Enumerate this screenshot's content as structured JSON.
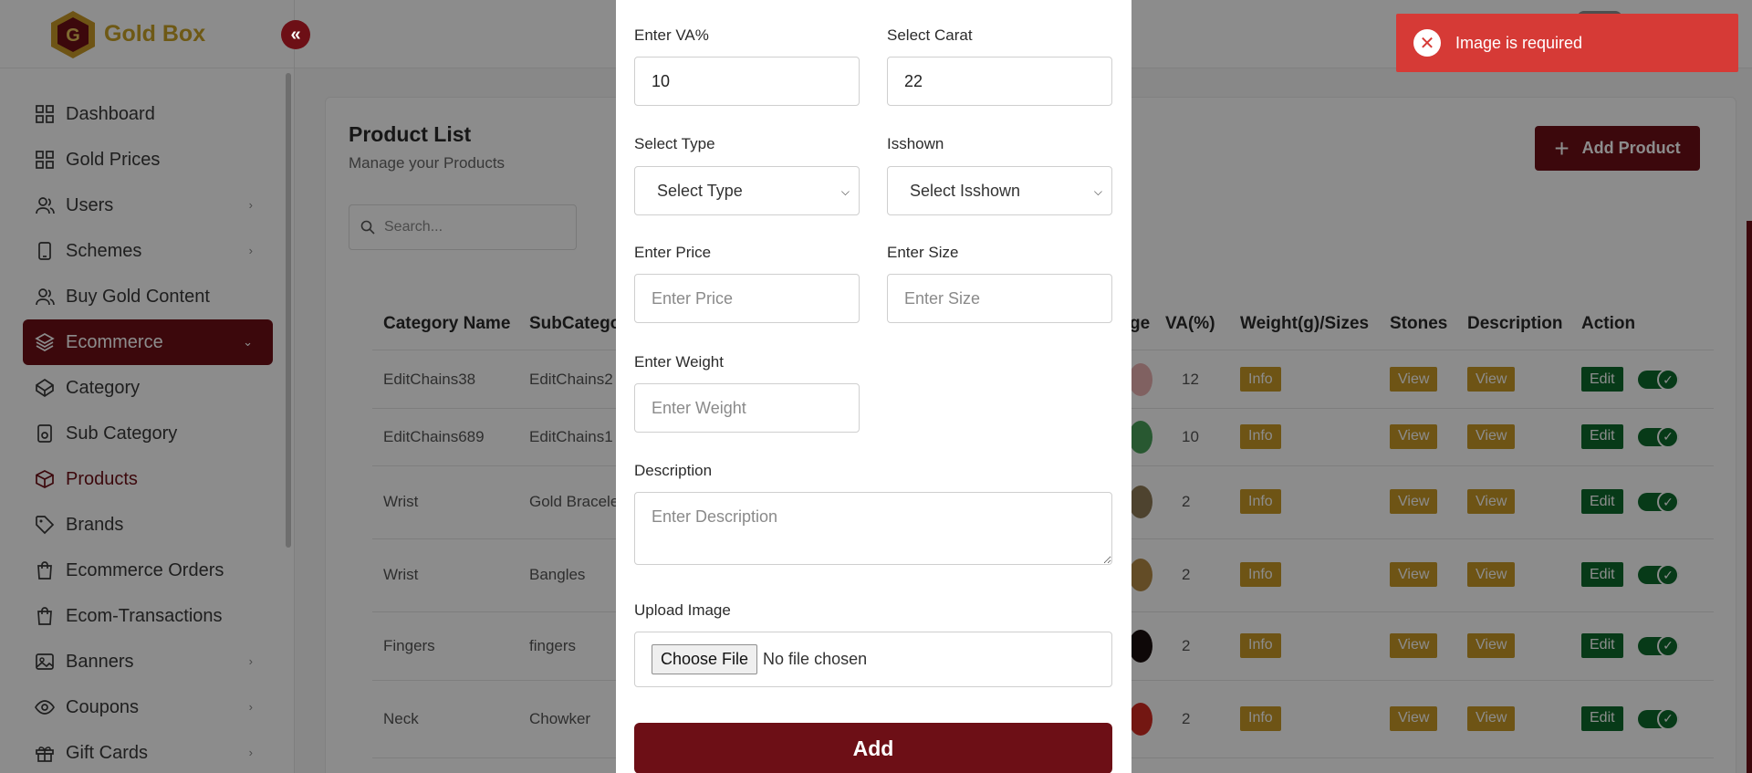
{
  "brand": {
    "name": "Gold Box"
  },
  "sidebar": {
    "collapse_icon": "«",
    "items": [
      {
        "label": "Dashboard",
        "icon": "grid-icon",
        "chevron": false
      },
      {
        "label": "Gold Prices",
        "icon": "grid-icon",
        "chevron": false
      },
      {
        "label": "Users",
        "icon": "users-icon",
        "chevron": true
      },
      {
        "label": "Schemes",
        "icon": "phone-icon",
        "chevron": true
      },
      {
        "label": "Buy Gold Content",
        "icon": "users-icon",
        "chevron": false
      },
      {
        "label": "Ecommerce",
        "icon": "layers-icon",
        "chevron": true,
        "active": true
      },
      {
        "label": "Category",
        "icon": "codepen-icon",
        "chevron": false
      },
      {
        "label": "Sub Category",
        "icon": "device-icon",
        "chevron": false
      },
      {
        "label": "Products",
        "icon": "box-icon",
        "chevron": false,
        "current": true
      },
      {
        "label": "Brands",
        "icon": "tag-icon",
        "chevron": false
      },
      {
        "label": "Ecommerce Orders",
        "icon": "shopping-bag-icon",
        "chevron": false
      },
      {
        "label": "Ecom-Transactions",
        "icon": "shopping-bag-icon",
        "chevron": false
      },
      {
        "label": "Banners",
        "icon": "image-icon",
        "chevron": true
      },
      {
        "label": "Coupons",
        "icon": "eye-icon",
        "chevron": true
      },
      {
        "label": "Gift Cards",
        "icon": "gift-icon",
        "chevron": true
      }
    ]
  },
  "page": {
    "title": "Product List",
    "subtitle": "Manage your Products",
    "search_placeholder": "Search...",
    "add_button": "Add Product"
  },
  "table": {
    "headers": {
      "category": "Category Name",
      "subcategory": "SubCatego",
      "image": "ge",
      "va": "VA(%)",
      "weight": "Weight(g)/Sizes",
      "stones": "Stones",
      "description": "Description",
      "action": "Action"
    },
    "rows": [
      {
        "category": "EditChains38",
        "subcategory": "EditChains2",
        "va": "12",
        "info": "Info",
        "stones": "View",
        "desc": "View",
        "edit": "Edit",
        "thumb": "#e9b1b1"
      },
      {
        "category": "EditChains689",
        "subcategory": "EditChains1",
        "va": "10",
        "info": "Info",
        "stones": "View",
        "desc": "View",
        "edit": "Edit",
        "thumb": "#4aa05a"
      },
      {
        "category": "Wrist",
        "subcategory": "Gold Bracelet",
        "va": "2",
        "info": "Info",
        "stones": "View",
        "desc": "View",
        "edit": "Edit",
        "thumb": "#8f7a56"
      },
      {
        "category": "Wrist",
        "subcategory": "Bangles",
        "va": "2",
        "info": "Info",
        "stones": "View",
        "desc": "View",
        "edit": "Edit",
        "thumb": "#b48a46"
      },
      {
        "category": "Fingers",
        "subcategory": "fingers",
        "va": "2",
        "info": "Info",
        "stones": "View",
        "desc": "View",
        "edit": "Edit",
        "thumb": "#1a0f10"
      },
      {
        "category": "Neck",
        "subcategory": "Chowker",
        "va": "2",
        "info": "Info",
        "stones": "View",
        "desc": "View",
        "edit": "Edit",
        "thumb": "#d22b22"
      }
    ]
  },
  "form": {
    "va_label": "Enter VA%",
    "va_value": "10",
    "carat_label": "Select Carat",
    "carat_value": "22",
    "type_label": "Select Type",
    "type_selected": "Select Type",
    "isshown_label": "Isshown",
    "isshown_selected": "Select Isshown",
    "price_label": "Enter Price",
    "price_placeholder": "Enter Price",
    "size_label": "Enter Size",
    "size_placeholder": "Enter Size",
    "weight_label": "Enter Weight",
    "weight_placeholder": "Enter Weight",
    "description_label": "Description",
    "description_placeholder": "Enter Description",
    "upload_label": "Upload Image",
    "choose_file": "Choose File",
    "no_file": "No file chosen",
    "submit": "Add"
  },
  "toast": {
    "message": "Image is required"
  },
  "colors": {
    "primary": "#6d0f16",
    "gold": "#c99a27",
    "success": "#0d6b2c",
    "error": "#d63a36"
  }
}
